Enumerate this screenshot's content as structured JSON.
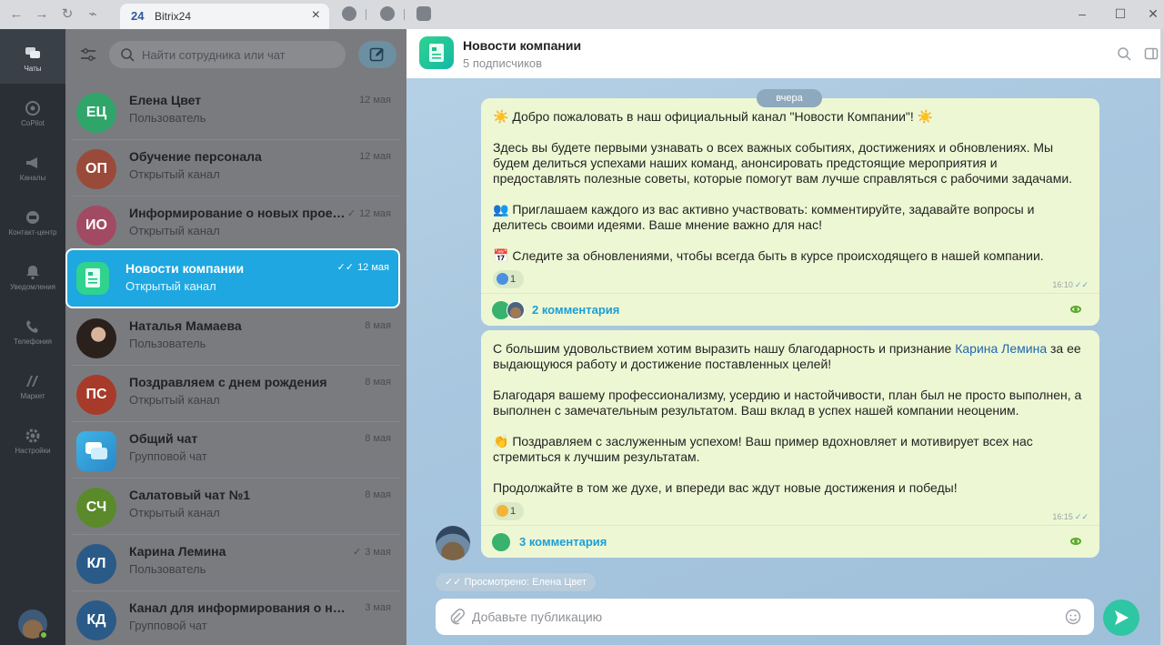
{
  "browser": {
    "tab_logo": "24",
    "tab_title": "Bitrix24",
    "tab_close": "×"
  },
  "rail": {
    "items": [
      {
        "label": "Чаты",
        "icon": "chat-icon"
      },
      {
        "label": "CoPilot",
        "icon": "copilot-icon"
      },
      {
        "label": "Каналы",
        "icon": "megaphone-icon"
      },
      {
        "label": "Контакт-центр",
        "icon": "contact-center-icon"
      },
      {
        "label": "Уведомления",
        "icon": "bell-icon"
      },
      {
        "label": "Телефония",
        "icon": "phone-icon"
      },
      {
        "label": "Маркет",
        "icon": "market-icon"
      },
      {
        "label": "Настройки",
        "icon": "gear-icon"
      }
    ]
  },
  "search": {
    "placeholder": "Найти сотрудника или чат"
  },
  "chats": [
    {
      "initials": "ЕЦ",
      "name": "Елена Цвет",
      "subtitle": "Пользователь",
      "date": "12 мая",
      "check": "",
      "color": "#2fa56a"
    },
    {
      "initials": "ОП",
      "name": "Обучение персонала",
      "subtitle": "Открытый канал",
      "date": "12 мая",
      "check": "",
      "color": "#9a4a3a"
    },
    {
      "initials": "ИО",
      "name": "Информирование о новых прое…",
      "subtitle": "Открытый канал",
      "date": "12 мая",
      "check": "✓",
      "color": "#a24a64"
    },
    {
      "initials": "",
      "name": "Новости компании",
      "subtitle": "Открытый канал",
      "date": "12 мая",
      "check": "✓✓",
      "color": "#2fd38f"
    },
    {
      "initials": "",
      "name": "Наталья Мамаева",
      "subtitle": "Пользователь",
      "date": "8 мая",
      "check": "",
      "color": "#4a3a36"
    },
    {
      "initials": "ПС",
      "name": "Поздравляем с днем рождения",
      "subtitle": "Открытый канал",
      "date": "8 мая",
      "check": "",
      "color": "#a83a2a"
    },
    {
      "initials": "",
      "name": "Общий чат",
      "subtitle": "Групповой чат",
      "date": "8 мая",
      "check": "",
      "color": "#3a82a8"
    },
    {
      "initials": "СЧ",
      "name": "Салатовый чат №1",
      "subtitle": "Открытый канал",
      "date": "8 мая",
      "check": "",
      "color": "#5a8a2a"
    },
    {
      "initials": "КЛ",
      "name": "Карина Лемина",
      "subtitle": "Пользователь",
      "date": "3 мая",
      "check": "✓",
      "color": "#2a5a88"
    },
    {
      "initials": "КД",
      "name": "Канал для информирования о нов…",
      "subtitle": "Групповой чат",
      "date": "3 мая",
      "check": "",
      "color": "#2a5a88"
    }
  ],
  "channel": {
    "title": "Новости компании",
    "subtitle": "5 подписчиков"
  },
  "day_label": "вчера",
  "messages": [
    {
      "paragraphs": [
        "☀️ Добро пожаловать в наш официальный канал \"Новости Компании\"! ☀️",
        "Здесь вы будете первыми узнавать о всех важных событиях, достижениях и обновлениях. Мы будем делиться успехами наших команд, анонсировать предстоящие мероприятия и предоставлять полезные советы, которые помогут вам лучше справляться с рабочими задачами.",
        "👥 Приглашаем каждого из вас активно участвовать: комментируйте, задавайте вопросы и делитесь своими идеями. Ваше мнение важно для нас!",
        "📅 Следите за обновлениями, чтобы всегда быть в курсе происходящего в нашей компании."
      ],
      "reaction_count": "1",
      "time": "16:10",
      "comments": "2 комментария"
    },
    {
      "p1_before": "С большим удовольствием хотим выразить нашу благодарность и признание ",
      "mention": "Карина Лемина",
      "p1_after": " за ее выдающуюся работу и достижение поставленных целей!",
      "paragraphs": [
        "Благодаря вашему профессионализму, усердию и настойчивости, план был не просто выполнен, а выполнен с замечательным результатом. Ваш вклад в успех нашей компании неоценим.",
        "👏 Поздравляем с заслуженным успехом! Ваш пример вдохновляет и мотивирует всех нас стремиться к лучшим результатам.",
        "Продолжайте в том же духе, и впереди вас ждут новые достижения и победы!"
      ],
      "reaction_count": "1",
      "time": "16:15",
      "comments": "3 комментария"
    }
  ],
  "seen_label": "Просмотрено: Елена Цвет",
  "composer": {
    "placeholder": "Добавьте публикацию"
  }
}
